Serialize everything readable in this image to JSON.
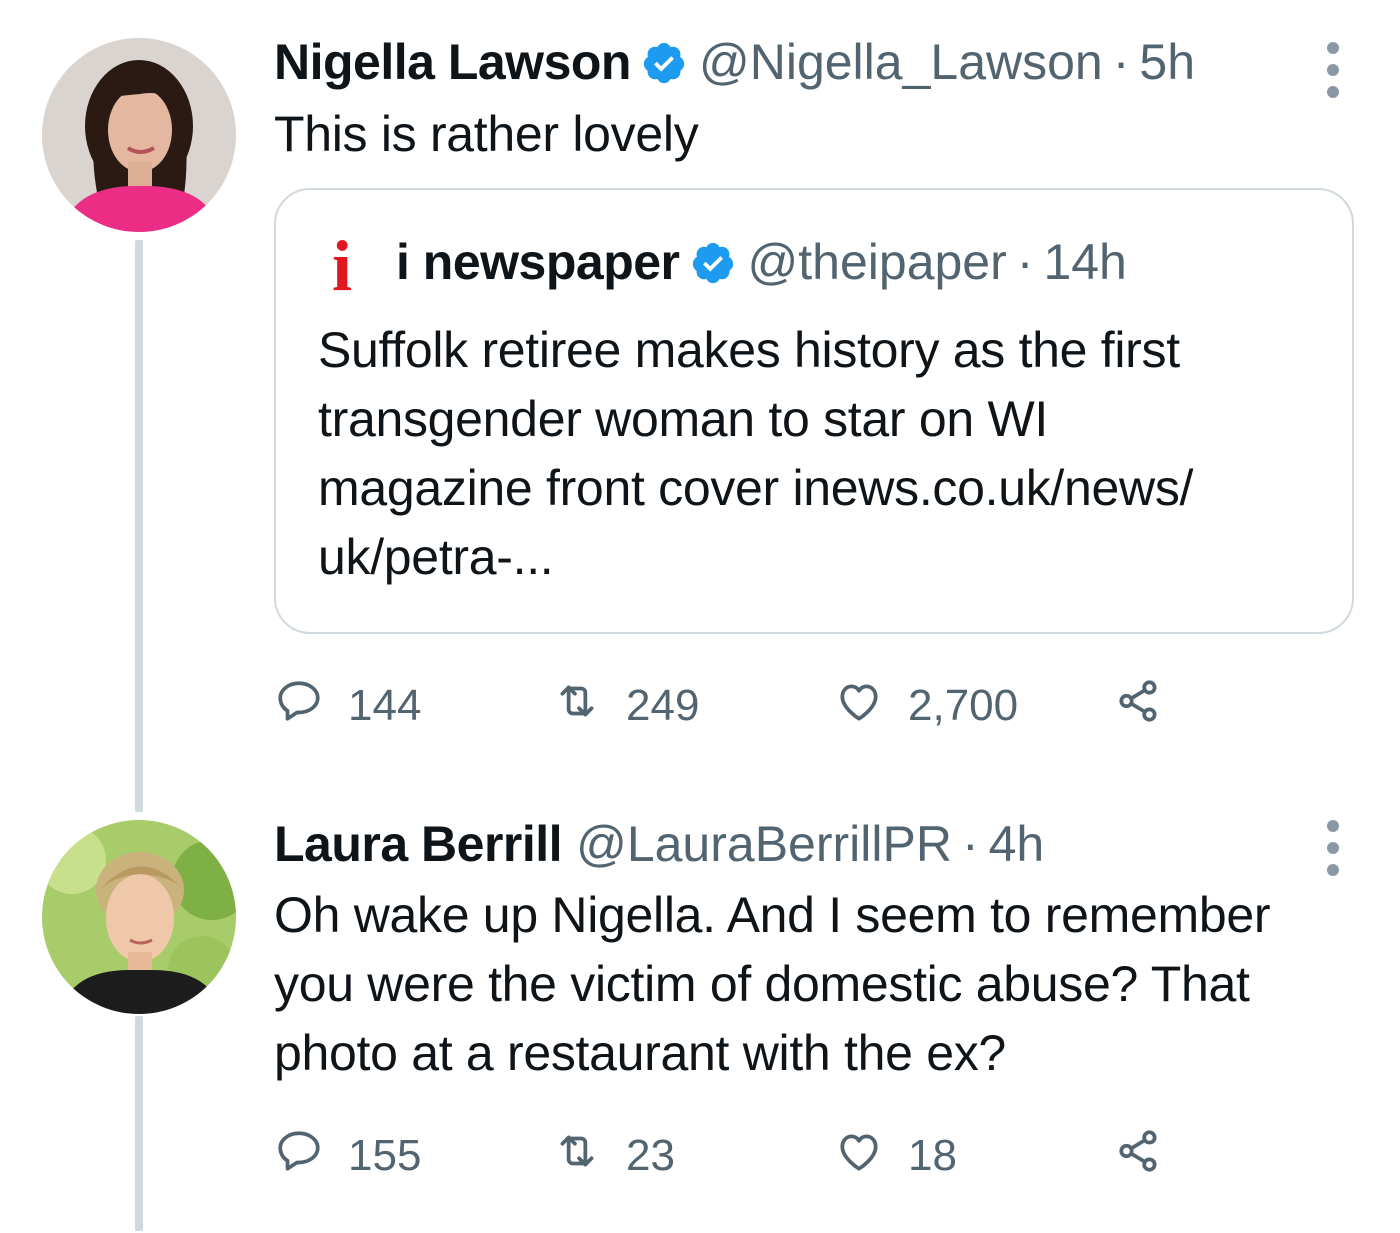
{
  "tweets": [
    {
      "author_name": "Nigella Lawson",
      "handle": "@Nigella_Lawson",
      "separator": "·",
      "time": "5h",
      "verified": true,
      "text": "This is rather lovely",
      "quoted": {
        "logo": "i",
        "author_name": "i newspaper",
        "handle": "@theipaper",
        "separator": "·",
        "time": "14h",
        "verified": true,
        "text_lines": [
          "Suffolk retiree makes history as the first",
          "transgender woman to star on WI",
          "magazine front cover inews.co.uk/news/",
          "uk/petra-..."
        ]
      },
      "actions": {
        "replies": "144",
        "retweets": "249",
        "likes": "2,700"
      }
    },
    {
      "author_name": "Laura Berrill",
      "handle": "@LauraBerrillPR",
      "separator": "·",
      "time": "4h",
      "verified": false,
      "text_lines": [
        "Oh wake up Nigella. And I seem to remember",
        "you were the victim of domestic abuse? That",
        "photo at a restaurant with the ex?"
      ],
      "actions": {
        "replies": "155",
        "retweets": "23",
        "likes": "18"
      }
    }
  ],
  "icons": {
    "reply": "reply-icon",
    "retweet": "retweet-icon",
    "like": "heart-icon",
    "share": "share-icon",
    "verified": "verified-badge-icon",
    "more": "more-vertical-icon"
  },
  "colors": {
    "verified_blue": "#1d9bf0",
    "muted_text": "#536471",
    "border": "#cfd9de",
    "i_logo_red": "#e0171f"
  }
}
